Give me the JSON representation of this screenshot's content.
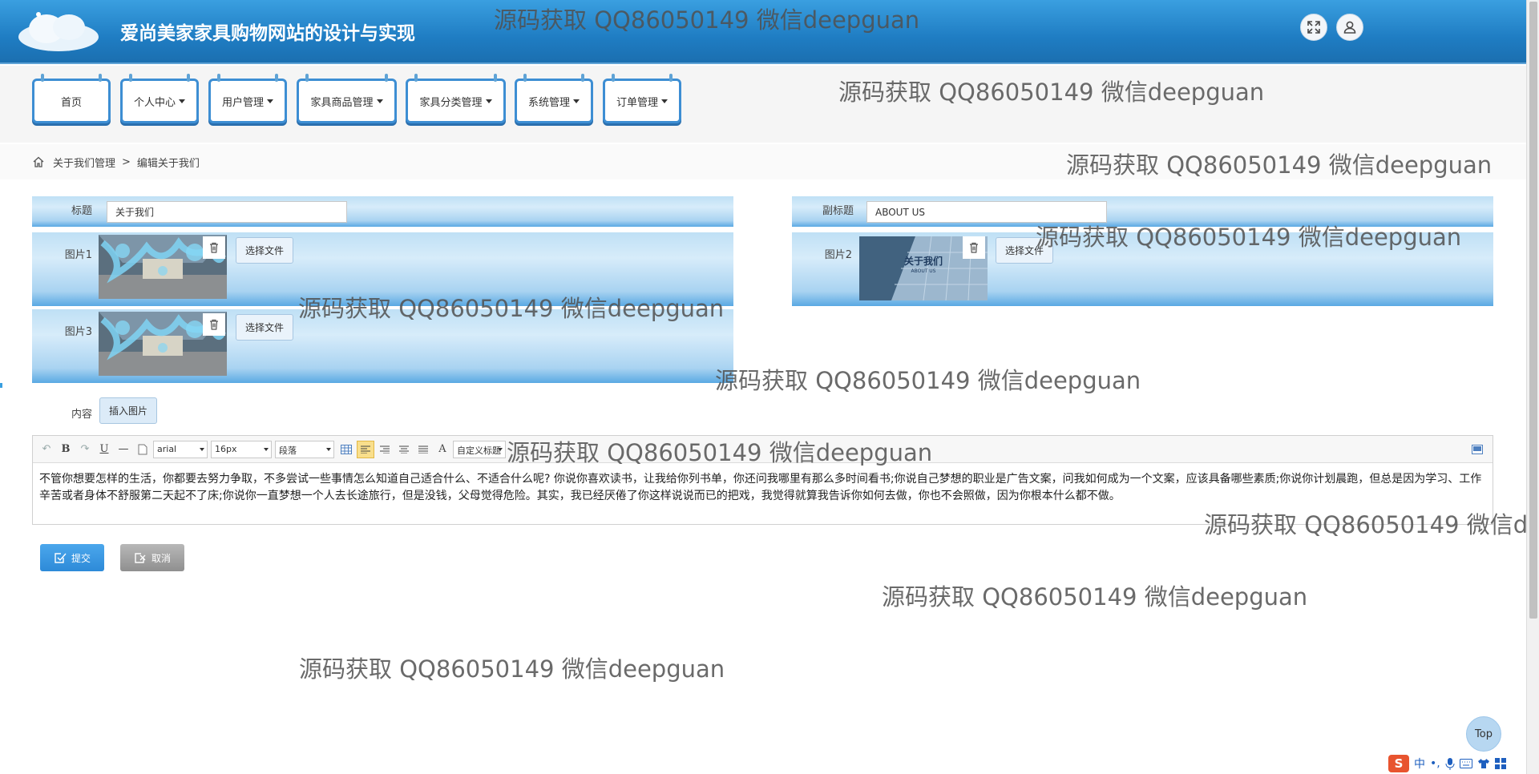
{
  "header": {
    "title": "爱尚美家家具购物网站的设计与实现",
    "fullscreen_icon": "expand-icon",
    "user_icon": "user-icon"
  },
  "nav": {
    "items": [
      {
        "label": "首页",
        "dropdown": false
      },
      {
        "label": "个人中心",
        "dropdown": true
      },
      {
        "label": "用户管理",
        "dropdown": true
      },
      {
        "label": "家具商品管理",
        "dropdown": true
      },
      {
        "label": "家具分类管理",
        "dropdown": true
      },
      {
        "label": "系统管理",
        "dropdown": true
      },
      {
        "label": "订单管理",
        "dropdown": true
      }
    ]
  },
  "breadcrumb": {
    "home_icon": "home-icon",
    "level1": "关于我们管理",
    "separator": ">",
    "level2": "编辑关于我们"
  },
  "form": {
    "title_label": "标题",
    "title_value": "关于我们",
    "subtitle_label": "副标题",
    "subtitle_value": "ABOUT US",
    "image1_label": "图片1",
    "image2_label": "图片2",
    "image3_label": "图片3",
    "choose_file": "选择文件",
    "image2_caption": "关于我们",
    "image2_caption_small": "ABOUT US",
    "content_label": "内容",
    "insert_image": "插入图片"
  },
  "editor": {
    "font_family": "arial",
    "font_size": "16px",
    "paragraph": "段落",
    "custom_title": "自定义标题",
    "content": "不管你想要怎样的生活，你都要去努力争取，不多尝试一些事情怎么知道自己适合什么、不适合什么呢? 你说你喜欢读书，让我给你列书单，你还问我哪里有那么多时间看书;你说自己梦想的职业是广告文案，问我如何成为一个文案，应该具备哪些素质;你说你计划晨跑，但总是因为学习、工作辛苦或者身体不舒服第二天起不了床;你说你一直梦想一个人去长途旅行，但是没钱，父母觉得危险。其实，我已经厌倦了你这样说说而已的把戏，我觉得就算我告诉你如何去做，你也不会照做，因为你根本什么都不做。"
  },
  "actions": {
    "submit": "提交",
    "cancel": "取消",
    "top": "Top"
  },
  "watermark": "源码获取 QQ86050149 微信deepguan",
  "ime": {
    "s": "S",
    "lang": "中"
  },
  "colors": {
    "header": "#1f7dc3",
    "band": "#a9d3f1",
    "submit": "#2d8ad8",
    "cancel": "#9a9a9a"
  }
}
